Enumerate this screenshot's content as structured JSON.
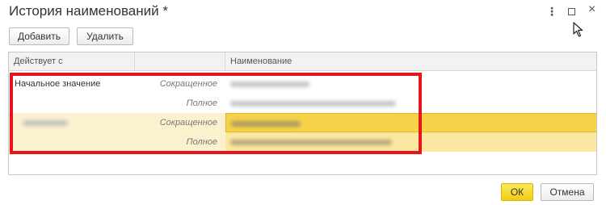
{
  "window": {
    "title": "История наименований *",
    "more_icon": "more-vertical-icon",
    "maximize_icon": "maximize-icon",
    "close_icon": "close-icon"
  },
  "toolbar": {
    "add_label": "Добавить",
    "delete_label": "Удалить"
  },
  "table": {
    "columns": [
      "Действует с",
      "",
      "Наименование"
    ],
    "rows": [
      {
        "effective_from": "Начальное значение",
        "kind": "Сокращенное",
        "name": ""
      },
      {
        "effective_from": "",
        "kind": "Полное",
        "name": ""
      },
      {
        "effective_from": "",
        "kind": "Сокращенное",
        "name": ""
      },
      {
        "effective_from": "",
        "kind": "Полное",
        "name": ""
      }
    ]
  },
  "footer": {
    "ok_label": "ОК",
    "cancel_label": "Отмена"
  },
  "colors": {
    "highlight_border": "#e8141c",
    "selected_row": "#fbf1cf",
    "selected_cell": "#f6d24a",
    "ok_button": "#f1cd16"
  }
}
